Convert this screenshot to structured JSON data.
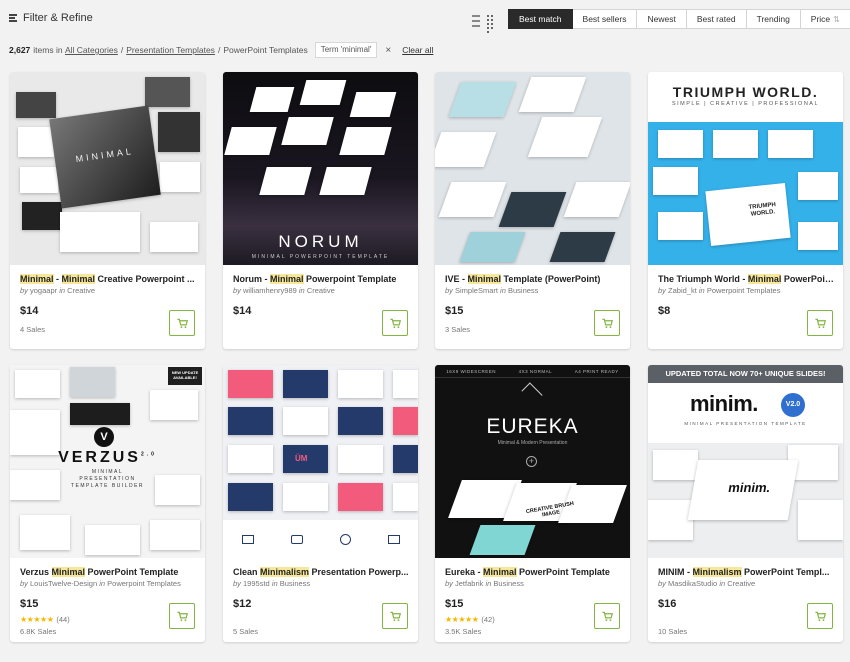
{
  "toolbar": {
    "filter_label": "Filter & Refine",
    "sort_tabs": [
      "Best match",
      "Best sellers",
      "Newest",
      "Best rated",
      "Trending",
      "Price"
    ],
    "active_sort": "Best match"
  },
  "breadcrumb": {
    "count": "2,627",
    "items_in": "items in",
    "links": [
      "All Categories",
      "Presentation Templates"
    ],
    "current": "PowerPoint Templates",
    "term_chip": "Term 'minimal'",
    "clear_all": "Clear all"
  },
  "cart_color": "#82b541",
  "cards": [
    {
      "t1": "Minimal",
      "t2": " - ",
      "t3": "Minimal",
      "t4": " Creative Powerpoint ...",
      "by": "by",
      "author": "yogaapr",
      "in": "in",
      "cat": "Creative",
      "price": "$14",
      "sales": "4 Sales",
      "thumb": {
        "word": "MINIMAL"
      }
    },
    {
      "t1": "",
      "t2": "Norum - ",
      "t3": "Minimal",
      "t4": " Powerpoint Template",
      "by": "by",
      "author": "williamhenry989",
      "in": "in",
      "cat": "Creative",
      "price": "$14",
      "sales": "",
      "thumb": {
        "word": "NORUM",
        "sub": "MINIMAL POWERPOINT TEMPLATE"
      }
    },
    {
      "t1": "",
      "t2": "IVE - ",
      "t3": "Minimal",
      "t4": " Template (PowerPoint)",
      "by": "by",
      "author": "SimpleSmart",
      "in": "in",
      "cat": "Business",
      "price": "$15",
      "sales": "3 Sales",
      "thumb": {}
    },
    {
      "t1": "",
      "t2": "The Triumph World - ",
      "t3": "Minimal",
      "t4": " PowerPoint ...",
      "by": "by",
      "author": "Zabid_kt",
      "in": "in",
      "cat": "Powerpoint Templates",
      "price": "$8",
      "sales": "",
      "thumb": {
        "word": "TRIUMPH WORLD.",
        "sub": "SIMPLE | CREATIVE | PROFESSIONAL",
        "slide": "TRIUMPH WORLD."
      }
    },
    {
      "t1": "",
      "t2": "Verzus ",
      "t3": "Minimal",
      "t4": " PowerPoint Template",
      "by": "by",
      "author": "LouisTwelve-Design",
      "in": "in",
      "cat": "Powerpoint Templates",
      "price": "$15",
      "rating": "(44)",
      "sales": "6.8K Sales",
      "thumb": {
        "word": "VERZUS",
        "sup": "2.0",
        "sub": "MINIMAL PRESENTATION TEMPLATE BUILDER",
        "badge": "NEW UPDATE AVAILABLE!"
      }
    },
    {
      "t1": "",
      "t2": "Clean ",
      "t3": "Minimalism",
      "t4": " Presentation Powerp...",
      "by": "by",
      "author": "1995std",
      "in": "in",
      "cat": "Business",
      "price": "$12",
      "sales": "5 Sales",
      "thumb": {
        "word": "ÜM"
      }
    },
    {
      "t1": "",
      "t2": "Eureka - ",
      "t3": "Minimal",
      "t4": " PowerPoint Template",
      "by": "by",
      "author": "Jetfabrik",
      "in": "in",
      "cat": "Business",
      "price": "$15",
      "rating": "(42)",
      "sales": "3.5K Sales",
      "thumb": {
        "word": "EUREKA",
        "sub": "Minimal & Modern Presentation",
        "tags": [
          "16X9 WIDESCREEN",
          "4X3 NORMAL",
          "A4 PRINT READY"
        ],
        "overlay": "CREATIVE BRUSH IMAGE"
      }
    },
    {
      "t1": "",
      "t2": "MINIM - ",
      "t3": "Minimalism",
      "t4": " PowerPoint Templ...",
      "by": "by",
      "author": "MasdikaStudio",
      "in": "in",
      "cat": "Creative",
      "price": "$16",
      "sales": "10 Sales",
      "thumb": {
        "word": "minim.",
        "sub": "MINIMAL PRESENTATION TEMPLATE",
        "banner": "UPDATED TOTAL NOW 70+ UNIQUE SLIDES!",
        "badge": "V2.0",
        "slide": "minim."
      }
    }
  ]
}
